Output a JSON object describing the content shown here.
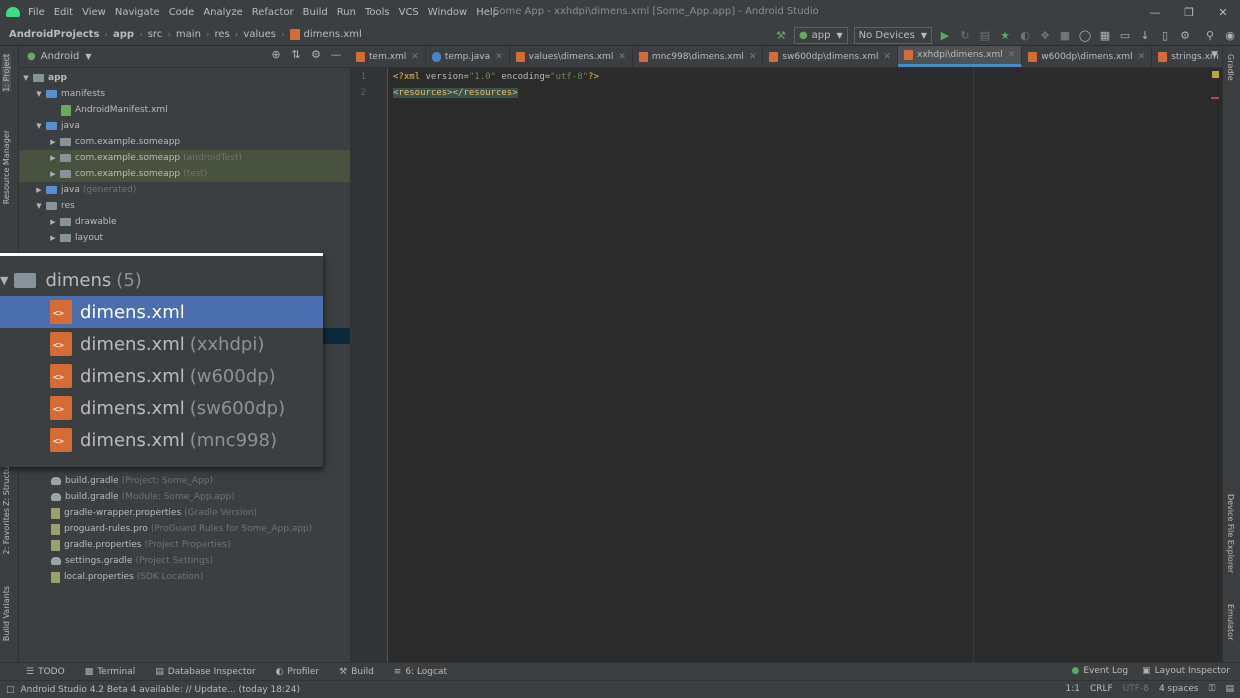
{
  "menubar": {
    "items": [
      "File",
      "Edit",
      "View",
      "Navigate",
      "Code",
      "Analyze",
      "Refactor",
      "Build",
      "Run",
      "Tools",
      "VCS",
      "Window",
      "Help"
    ],
    "window_title": "Some App - xxhdpi\\dimens.xml [Some_App.app] - Android Studio"
  },
  "breadcrumbs": [
    "AndroidProjects",
    "app",
    "src",
    "main",
    "res",
    "values",
    "dimens.xml"
  ],
  "toolbar": {
    "run_config": "app",
    "device": "No Devices"
  },
  "project_panel": {
    "view_mode": "Android"
  },
  "tree": [
    {
      "label": "app",
      "hint": "",
      "depth": 0,
      "arrow": "▼",
      "icon": "folder"
    },
    {
      "label": "manifests",
      "hint": "",
      "depth": 1,
      "arrow": "▼",
      "icon": "folder-blue"
    },
    {
      "label": "AndroidManifest.xml",
      "hint": "",
      "depth": 2,
      "arrow": "",
      "icon": "xml"
    },
    {
      "label": "java",
      "hint": "",
      "depth": 1,
      "arrow": "▼",
      "icon": "folder-blue"
    },
    {
      "label": "com.example.someapp",
      "hint": "",
      "depth": 2,
      "arrow": "▶",
      "icon": "folder"
    },
    {
      "label": "com.example.someapp",
      "hint": "(androidTest)",
      "depth": 2,
      "arrow": "▶",
      "icon": "folder",
      "highlight": "green"
    },
    {
      "label": "com.example.someapp",
      "hint": "(test)",
      "depth": 2,
      "arrow": "▶",
      "icon": "folder",
      "highlight": "green"
    },
    {
      "label": "java",
      "hint": "(generated)",
      "depth": 1,
      "arrow": "▶",
      "icon": "folder-blue"
    },
    {
      "label": "res",
      "hint": "",
      "depth": 1,
      "arrow": "▼",
      "icon": "folder"
    },
    {
      "label": "drawable",
      "hint": "",
      "depth": 2,
      "arrow": "▶",
      "icon": "folder"
    },
    {
      "label": "layout",
      "hint": "",
      "depth": 2,
      "arrow": "▶",
      "icon": "folder"
    }
  ],
  "tree_lower": [
    {
      "label": "build.gradle",
      "hint": "(Project: Some_App)",
      "icon": "gradle"
    },
    {
      "label": "build.gradle",
      "hint": "(Module: Some_App.app)",
      "icon": "gradle"
    },
    {
      "label": "gradle-wrapper.properties",
      "hint": "(Gradle Version)",
      "icon": "props"
    },
    {
      "label": "proguard-rules.pro",
      "hint": "(ProGuard Rules for Some_App.app)",
      "icon": "props"
    },
    {
      "label": "gradle.properties",
      "hint": "(Project Properties)",
      "icon": "props"
    },
    {
      "label": "settings.gradle",
      "hint": "(Project Settings)",
      "icon": "gradle"
    },
    {
      "label": "local.properties",
      "hint": "(SDK Location)",
      "icon": "props"
    }
  ],
  "zoom_popup": {
    "folder_label": "dimens",
    "folder_count": "(5)",
    "files": [
      {
        "name": "dimens.xml",
        "qualifier": ""
      },
      {
        "name": "dimens.xml",
        "qualifier": "(xxhdpi)"
      },
      {
        "name": "dimens.xml",
        "qualifier": "(w600dp)"
      },
      {
        "name": "dimens.xml",
        "qualifier": "(sw600dp)"
      },
      {
        "name": "dimens.xml",
        "qualifier": "(mnc998)"
      }
    ]
  },
  "editor_tabs": [
    {
      "label": "tem.xml",
      "type": "xml"
    },
    {
      "label": "temp.java",
      "type": "java"
    },
    {
      "label": "values\\dimens.xml",
      "type": "xml"
    },
    {
      "label": "mnc998\\dimens.xml",
      "type": "xml"
    },
    {
      "label": "sw600dp\\dimens.xml",
      "type": "xml"
    },
    {
      "label": "xxhdpi\\dimens.xml",
      "type": "xml",
      "active": true
    },
    {
      "label": "w600dp\\dimens.xml",
      "type": "xml"
    },
    {
      "label": "strings.xm",
      "type": "xml"
    }
  ],
  "editor": {
    "line_numbers": [
      "1",
      "2"
    ],
    "line1": {
      "open": "<?xml ",
      "a1": "version",
      "eq1": "=",
      "v1": "\"1.0\"",
      "a2": " encoding",
      "eq2": "=",
      "v2": "\"utf-8\"",
      "close": "?>"
    },
    "line2": "<resources></resources>"
  },
  "left_strip_tabs": [
    "1: Project",
    "Resource Manager",
    "Z: Structure",
    "2: Favorites",
    "Build Variants"
  ],
  "right_strip_tabs": [
    "Gradle",
    "Device File Explorer",
    "Emulator"
  ],
  "bottom_tabs": [
    "TODO",
    "Terminal",
    "Database Inspector",
    "Profiler",
    "Build",
    "6: Logcat"
  ],
  "bottom_tabs_right": [
    "Event Log",
    "Layout Inspector"
  ],
  "status": {
    "message": "Android Studio 4.2 Beta 4 available: // Update... (today 18:24)",
    "position": "1:1",
    "line_sep": "CRLF",
    "encoding": "UTF-8",
    "indent": "4 spaces"
  }
}
